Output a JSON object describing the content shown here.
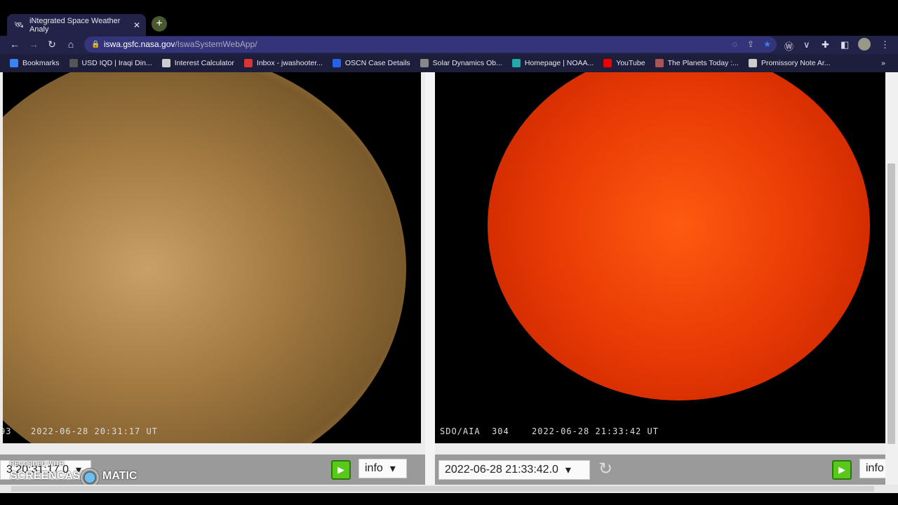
{
  "browser": {
    "tab_title": "iNtegrated Space Weather Analy",
    "url_host": "iswa.gsfc.nasa.gov",
    "url_path": "/IswaSystemWebApp/",
    "bookmarks": [
      "Bookmarks",
      "USD IQD | Iraqi Din...",
      "Interest Calculator",
      "Inbox - jwashooter...",
      "OSCN Case Details",
      "Solar Dynamics Ob...",
      "Homepage | NOAA...",
      "YouTube",
      "The Planets Today :...",
      "Promissory Note Ar..."
    ],
    "bookmark_colors": [
      "#3b82f6",
      "#555",
      "#ccc",
      "#d33",
      "#2563eb",
      "#888",
      "#2aa",
      "#e00",
      "#a55",
      "#ccc"
    ]
  },
  "left_panel": {
    "caption_prefix": "93",
    "caption": "2022-06-28 20:31:17 UT",
    "time_value": "3 20:31:17.0",
    "info_label": "info"
  },
  "right_panel": {
    "caption_prefix": "SDO/AIA  304",
    "caption": "2022-06-28 21:33:42 UT",
    "time_value": "2022-06-28 21:33:42.0",
    "info_label": "info"
  },
  "watermark": {
    "top": "RECORDED WITH",
    "left": "SCREENCAST",
    "right": "MATIC"
  }
}
